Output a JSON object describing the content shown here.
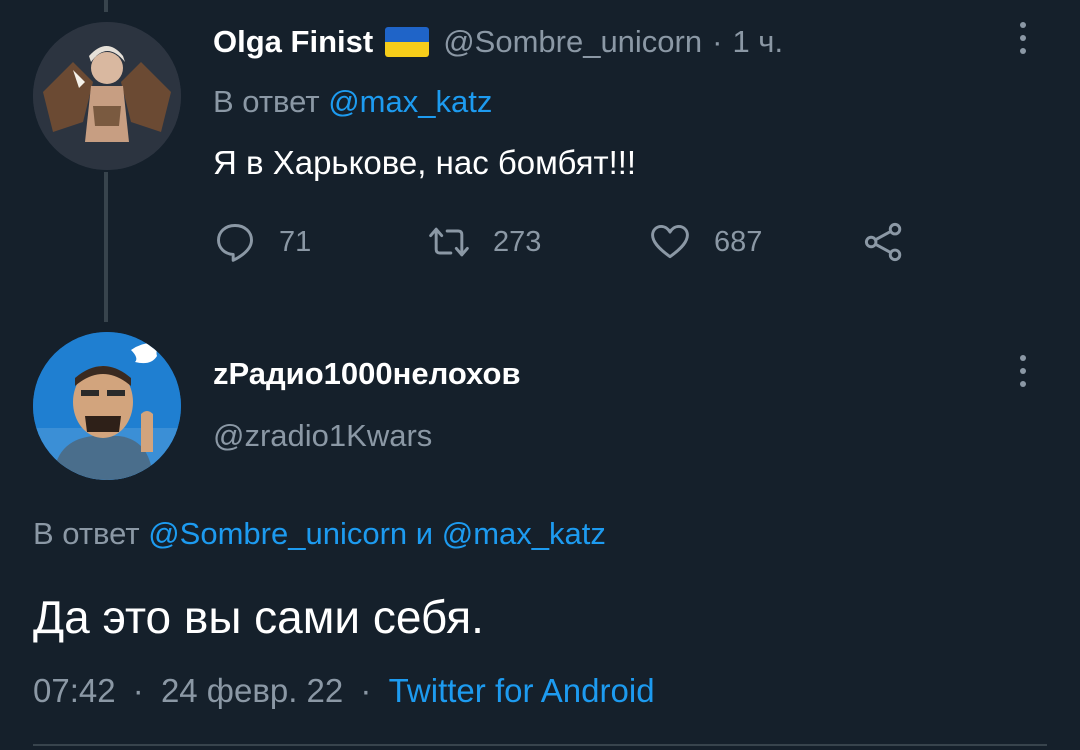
{
  "colors": {
    "background": "#15202b",
    "text": "#ffffff",
    "muted": "#8b98a5",
    "link": "#1d9bf0",
    "divider": "#38444d"
  },
  "tweet1": {
    "author_name": "Olga Finist",
    "author_flag": "ukraine-flag-icon",
    "handle": "@Sombre_unicorn",
    "separator": "·",
    "time": "1 ч.",
    "reply_prefix": "В ответ",
    "reply_to": "@max_katz",
    "text": "Я в Харькове, нас бомбят!!!",
    "actions": {
      "reply_count": "71",
      "retweet_count": "273",
      "like_count": "687"
    }
  },
  "tweet2": {
    "author_name": "zРадио1000нелохов",
    "handle": "@zradio1Kwars",
    "reply_prefix": "В ответ",
    "reply_to_1": "@Sombre_unicorn",
    "reply_conj": "и",
    "reply_to_2": "@max_katz",
    "text": "Да это вы сами себя.",
    "time": "07:42",
    "sep1": "·",
    "date": "24 февр. 22",
    "sep2": "·",
    "source": "Twitter for Android"
  }
}
